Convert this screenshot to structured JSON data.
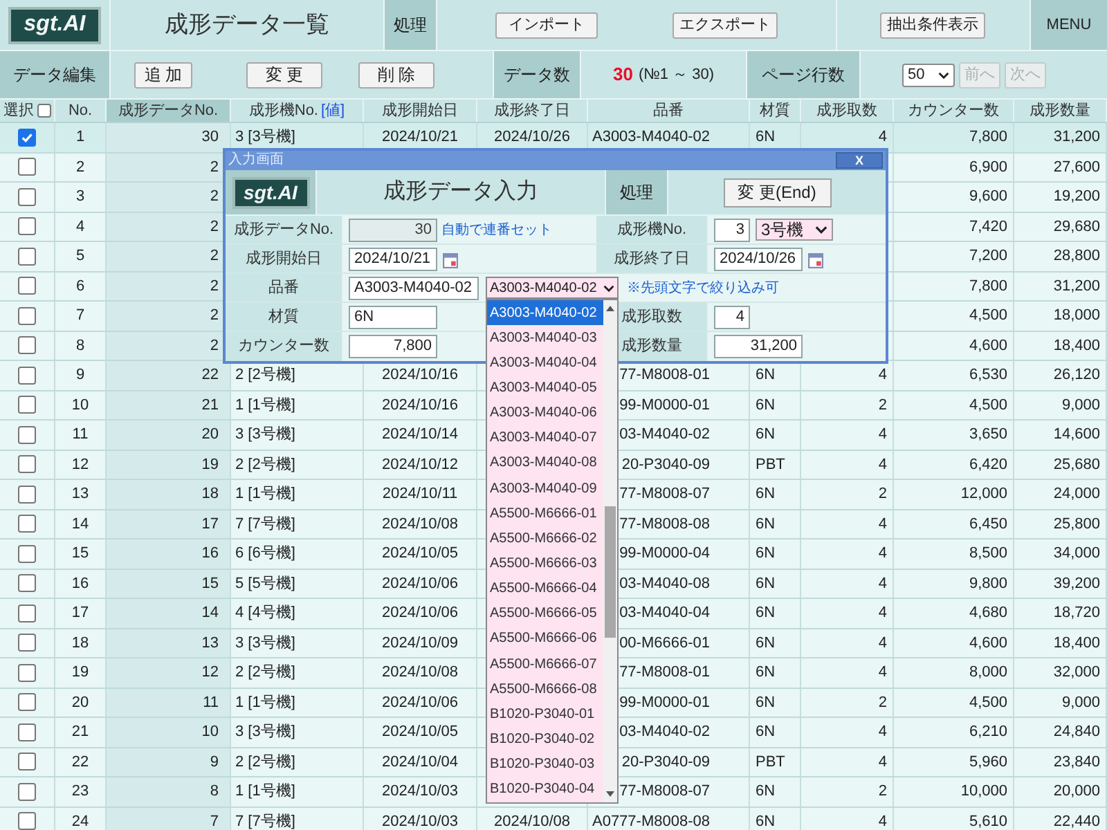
{
  "header": {
    "logo": "sgt.AI",
    "title": "成形データ一覧",
    "process_label": "処理",
    "actions": [
      "インポート",
      "エクスポート"
    ],
    "filter_button": "抽出条件表示",
    "menu": "MENU"
  },
  "toolbar": {
    "edit_label": "データ編集",
    "edit_buttons": [
      "追 加",
      "変 更",
      "削 除"
    ],
    "count_label": "データ数",
    "count": "30",
    "count_range": "(№1 ～ 30)",
    "page_rows_label": "ページ行数",
    "page_rows": "50",
    "pager": [
      {
        "label": "前へ",
        "disabled": true
      },
      {
        "label": "次へ",
        "disabled": true
      }
    ]
  },
  "table": {
    "columns": [
      {
        "label": "選択",
        "kind": "checkbox",
        "checked": false,
        "selected": false
      },
      {
        "label": "No.",
        "kind": "text",
        "selected": false
      },
      {
        "label": "成形データNo.",
        "kind": "text",
        "selected": true
      },
      {
        "label": "成形機No.",
        "kind": "link",
        "link": "[値]",
        "selected": false
      },
      {
        "label": "成形開始日",
        "kind": "text",
        "selected": false
      },
      {
        "label": "成形終了日",
        "kind": "text",
        "selected": false
      },
      {
        "label": "品番",
        "kind": "text",
        "selected": false
      },
      {
        "label": "材質",
        "kind": "text",
        "selected": false
      },
      {
        "label": "成形取数",
        "kind": "text",
        "selected": false
      },
      {
        "label": "カウンター数",
        "kind": "text",
        "selected": false
      },
      {
        "label": "成形数量",
        "kind": "text",
        "selected": false
      }
    ],
    "rows": [
      {
        "selected": true,
        "checked": true,
        "no": "1",
        "data_no": "30",
        "machine": "3 [3号機]",
        "start": "2024/10/21",
        "end": "2024/10/26",
        "part": "A3003-M4040-02",
        "material": "6N",
        "cavities": "4",
        "counter": "7,800",
        "quantity": "31,200"
      },
      {
        "selected": false,
        "checked": false,
        "no": "2",
        "data_no": "2",
        "counter": "6,900",
        "quantity": "27,600"
      },
      {
        "selected": false,
        "checked": false,
        "no": "3",
        "data_no": "2",
        "counter": "9,600",
        "quantity": "19,200"
      },
      {
        "selected": false,
        "checked": false,
        "no": "4",
        "data_no": "2",
        "counter": "7,420",
        "quantity": "29,680"
      },
      {
        "selected": false,
        "checked": false,
        "no": "5",
        "data_no": "2",
        "counter": "7,200",
        "quantity": "28,800"
      },
      {
        "selected": false,
        "checked": false,
        "no": "6",
        "data_no": "2",
        "counter": "7,800",
        "quantity": "31,200"
      },
      {
        "selected": false,
        "checked": false,
        "no": "7",
        "data_no": "2",
        "counter": "4,500",
        "quantity": "18,000"
      },
      {
        "selected": false,
        "checked": false,
        "no": "8",
        "data_no": "2",
        "counter": "4,600",
        "quantity": "18,400"
      },
      {
        "selected": false,
        "checked": false,
        "no": "9",
        "data_no": "22",
        "machine": "2 [2号機]",
        "start": "2024/10/16",
        "part": "77-M8008-01",
        "material": "6N",
        "cavities": "4",
        "counter": "6,530",
        "quantity": "26,120"
      },
      {
        "selected": false,
        "checked": false,
        "no": "10",
        "data_no": "21",
        "machine": "1 [1号機]",
        "start": "2024/10/16",
        "part": "99-M0000-01",
        "material": "6N",
        "cavities": "2",
        "counter": "4,500",
        "quantity": "9,000"
      },
      {
        "selected": false,
        "checked": false,
        "no": "11",
        "data_no": "20",
        "machine": "3 [3号機]",
        "start": "2024/10/14",
        "part": "03-M4040-02",
        "material": "6N",
        "cavities": "4",
        "counter": "3,650",
        "quantity": "14,600"
      },
      {
        "selected": false,
        "checked": false,
        "no": "12",
        "data_no": "19",
        "machine": "2 [2号機]",
        "start": "2024/10/12",
        "part": "20-P3040-09",
        "material": "PBT",
        "cavities": "4",
        "counter": "6,420",
        "quantity": "25,680"
      },
      {
        "selected": false,
        "checked": false,
        "no": "13",
        "data_no": "18",
        "machine": "1 [1号機]",
        "start": "2024/10/11",
        "part": "77-M8008-07",
        "material": "6N",
        "cavities": "2",
        "counter": "12,000",
        "quantity": "24,000"
      },
      {
        "selected": false,
        "checked": false,
        "no": "14",
        "data_no": "17",
        "machine": "7 [7号機]",
        "start": "2024/10/08",
        "part": "77-M8008-08",
        "material": "6N",
        "cavities": "4",
        "counter": "6,450",
        "quantity": "25,800"
      },
      {
        "selected": false,
        "checked": false,
        "no": "15",
        "data_no": "16",
        "machine": "6 [6号機]",
        "start": "2024/10/05",
        "part": "99-M0000-04",
        "material": "6N",
        "cavities": "4",
        "counter": "8,500",
        "quantity": "34,000"
      },
      {
        "selected": false,
        "checked": false,
        "no": "16",
        "data_no": "15",
        "machine": "5 [5号機]",
        "start": "2024/10/06",
        "part": "03-M4040-08",
        "material": "6N",
        "cavities": "4",
        "counter": "9,800",
        "quantity": "39,200"
      },
      {
        "selected": false,
        "checked": false,
        "no": "17",
        "data_no": "14",
        "machine": "4 [4号機]",
        "start": "2024/10/06",
        "part": "03-M4040-04",
        "material": "6N",
        "cavities": "4",
        "counter": "4,680",
        "quantity": "18,720"
      },
      {
        "selected": false,
        "checked": false,
        "no": "18",
        "data_no": "13",
        "machine": "3 [3号機]",
        "start": "2024/10/09",
        "part": "00-M6666-01",
        "material": "6N",
        "cavities": "4",
        "counter": "4,600",
        "quantity": "18,400"
      },
      {
        "selected": false,
        "checked": false,
        "no": "19",
        "data_no": "12",
        "machine": "2 [2号機]",
        "start": "2024/10/08",
        "part": "77-M8008-01",
        "material": "6N",
        "cavities": "4",
        "counter": "8,000",
        "quantity": "32,000"
      },
      {
        "selected": false,
        "checked": false,
        "no": "20",
        "data_no": "11",
        "machine": "1 [1号機]",
        "start": "2024/10/06",
        "part": "99-M0000-01",
        "material": "6N",
        "cavities": "2",
        "counter": "4,500",
        "quantity": "9,000"
      },
      {
        "selected": false,
        "checked": false,
        "no": "21",
        "data_no": "10",
        "machine": "3 [3号機]",
        "start": "2024/10/05",
        "part": "03-M4040-02",
        "material": "6N",
        "cavities": "4",
        "counter": "6,210",
        "quantity": "24,840"
      },
      {
        "selected": false,
        "checked": false,
        "no": "22",
        "data_no": "9",
        "machine": "2 [2号機]",
        "start": "2024/10/04",
        "part": "20-P3040-09",
        "material": "PBT",
        "cavities": "4",
        "counter": "5,960",
        "quantity": "23,840"
      },
      {
        "selected": false,
        "checked": false,
        "no": "23",
        "data_no": "8",
        "machine": "1 [1号機]",
        "start": "2024/10/03",
        "part": "77-M8008-07",
        "material": "6N",
        "cavities": "2",
        "counter": "10,000",
        "quantity": "20,000"
      },
      {
        "selected": false,
        "checked": false,
        "no": "24",
        "data_no": "7",
        "machine": "7 [7号機]",
        "start": "2024/10/03",
        "end": "2024/10/08",
        "part": "A0777-M8008-08",
        "material": "6N",
        "cavities": "4",
        "counter": "5,610",
        "quantity": "22,440"
      }
    ]
  },
  "dialog": {
    "title": "入力画面",
    "close": "X",
    "logo": "sgt.AI",
    "heading": "成形データ入力",
    "process_label": "処理",
    "submit": "変 更(End)",
    "form": {
      "data_no": {
        "label": "成形データNo.",
        "value": "30",
        "disabled": true,
        "note": "自動で連番セット"
      },
      "machine": {
        "label": "成形機No.",
        "value": "3",
        "choice": "3号機"
      },
      "start": {
        "label": "成形開始日",
        "value": "2024/10/21"
      },
      "end": {
        "label": "成形終了日",
        "value": "2024/10/26"
      },
      "part": {
        "label": "品番",
        "value": "A3003-M4040-02",
        "choice": "A3003-M4040-02",
        "expanded": true,
        "note": "※先頭文字で絞り込み可",
        "options": [
          {
            "label": "A3003-M4040-02",
            "selected": true
          },
          {
            "label": "A3003-M4040-03",
            "selected": false
          },
          {
            "label": "A3003-M4040-04",
            "selected": false
          },
          {
            "label": "A3003-M4040-05",
            "selected": false
          },
          {
            "label": "A3003-M4040-06",
            "selected": false
          },
          {
            "label": "A3003-M4040-07",
            "selected": false
          },
          {
            "label": "A3003-M4040-08",
            "selected": false
          },
          {
            "label": "A3003-M4040-09",
            "selected": false
          },
          {
            "label": "A5500-M6666-01",
            "selected": false
          },
          {
            "label": "A5500-M6666-02",
            "selected": false
          },
          {
            "label": "A5500-M6666-03",
            "selected": false
          },
          {
            "label": "A5500-M6666-04",
            "selected": false
          },
          {
            "label": "A5500-M6666-05",
            "selected": false
          },
          {
            "label": "A5500-M6666-06",
            "selected": false
          },
          {
            "label": "A5500-M6666-07",
            "selected": false
          },
          {
            "label": "A5500-M6666-08",
            "selected": false
          },
          {
            "label": "B1020-P3040-01",
            "selected": false
          },
          {
            "label": "B1020-P3040-02",
            "selected": false
          },
          {
            "label": "B1020-P3040-03",
            "selected": false
          },
          {
            "label": "B1020-P3040-04",
            "selected": false
          }
        ]
      },
      "material": {
        "label": "材質",
        "value": "6N"
      },
      "cavities": {
        "label": "成形取数",
        "value": "4"
      },
      "counter": {
        "label": "カウンター数",
        "value": "7,800"
      },
      "quantity": {
        "label": "成形数量",
        "value": "31,200"
      }
    }
  }
}
